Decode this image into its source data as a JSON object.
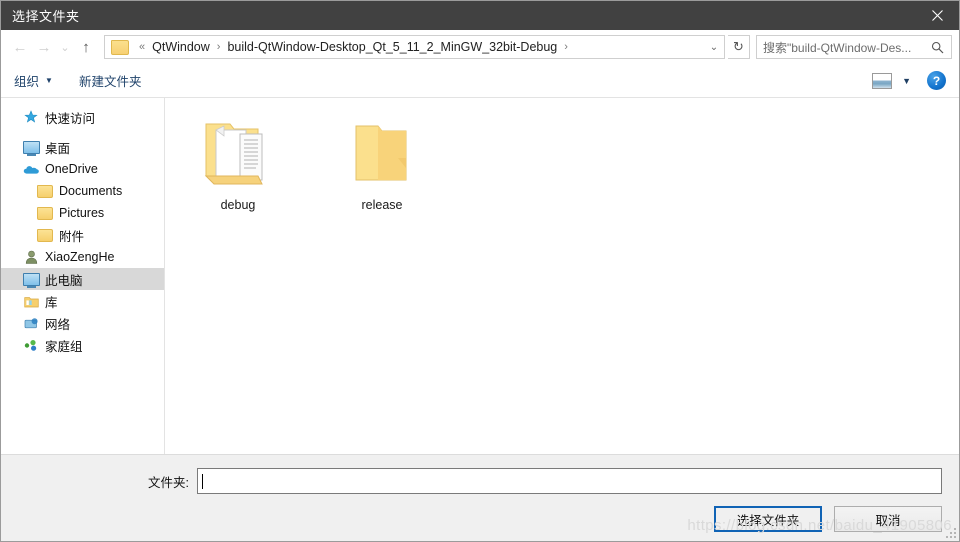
{
  "window": {
    "title": "选择文件夹",
    "close_label": "✕"
  },
  "navbar": {
    "back_icon": "←",
    "forward_icon": "→",
    "recent_icon": "⌄",
    "up_icon": "↑",
    "breadcrumb": {
      "root_sep": "«",
      "items": [
        "QtWindow",
        "build-QtWindow-Desktop_Qt_5_11_2_MinGW_32bit-Debug"
      ],
      "separator": "›",
      "trailing_separator": "›"
    },
    "address_dropdown_icon": "⌄",
    "refresh_icon": "↻",
    "search": {
      "placeholder": "搜索\"build-QtWindow-Des...",
      "icon": "search-icon"
    }
  },
  "toolbar": {
    "organize_label": "组织",
    "organize_caret": "▼",
    "new_folder_label": "新建文件夹",
    "view_caret": "▼",
    "help_label": "?"
  },
  "sidebar": {
    "items": [
      {
        "label": "快速访问",
        "icon": "star-icon",
        "level": 0,
        "selected": false
      },
      {
        "label": "桌面",
        "icon": "monitor-icon",
        "level": 0,
        "selected": false
      },
      {
        "label": "OneDrive",
        "icon": "cloud-icon",
        "level": 0,
        "selected": false
      },
      {
        "label": "Documents",
        "icon": "folder-icon",
        "level": 1,
        "selected": false
      },
      {
        "label": "Pictures",
        "icon": "folder-icon",
        "level": 1,
        "selected": false
      },
      {
        "label": "附件",
        "icon": "folder-icon",
        "level": 1,
        "selected": false
      },
      {
        "label": "XiaoZengHe",
        "icon": "user-icon",
        "level": 0,
        "selected": false
      },
      {
        "label": "此电脑",
        "icon": "monitor-icon",
        "level": 0,
        "selected": true
      },
      {
        "label": "库",
        "icon": "library-icon",
        "level": 0,
        "selected": false
      },
      {
        "label": "网络",
        "icon": "network-icon",
        "level": 0,
        "selected": false
      },
      {
        "label": "家庭组",
        "icon": "homegroup-icon",
        "level": 0,
        "selected": false
      }
    ]
  },
  "content": {
    "files": [
      {
        "name": "debug",
        "icon": "open-folder-with-documents-icon"
      },
      {
        "name": "release",
        "icon": "closed-folder-icon"
      }
    ]
  },
  "bottom": {
    "folder_label": "文件夹:",
    "folder_value": "",
    "folder_placeholder": "",
    "accept_button": "选择文件夹",
    "cancel_button": "取消"
  },
  "watermark": "https://blog.csdn.net/baidu_41905806",
  "colors": {
    "titlebar": "#414141",
    "accent": "#1063b5",
    "selection": "#d8d8d8",
    "panel": "#f0f0f0",
    "folder_yellow": "#f7d073"
  }
}
